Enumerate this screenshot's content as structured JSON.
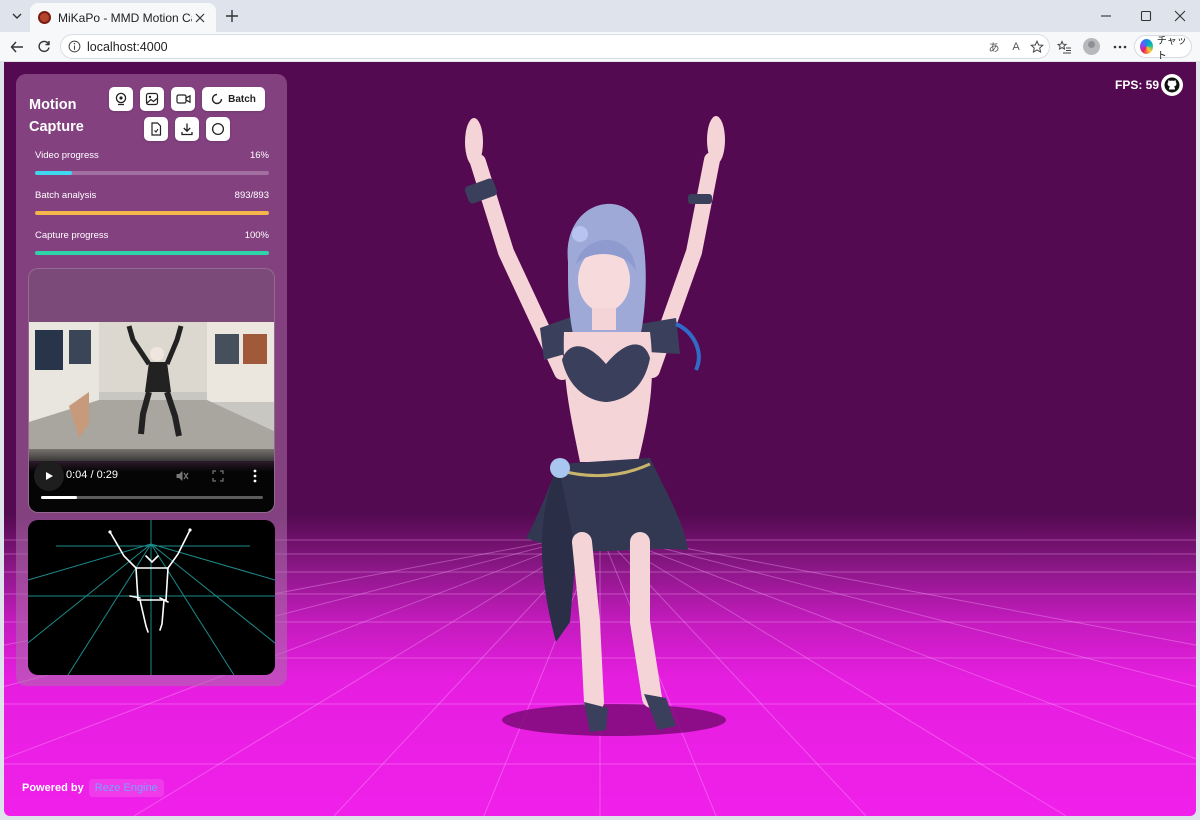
{
  "browser": {
    "tab_title": "MiKaPo - MMD Motion Capture",
    "url": "localhost:4000",
    "copilot_label": "チャット",
    "read_aloud_label": "A",
    "translate_label": "あ"
  },
  "app": {
    "fps_label": "FPS: 59",
    "panel_title": "Motion Capture",
    "buttons": {
      "batch_label": "Batch"
    },
    "progress": [
      {
        "label": "Video progress",
        "value_text": "16%",
        "fraction": 0.16,
        "color": "#3fd7ef"
      },
      {
        "label": "Batch analysis",
        "value_text": "893/893",
        "fraction": 1.0,
        "color": "#f5b54a"
      },
      {
        "label": "Capture progress",
        "value_text": "100%",
        "fraction": 1.0,
        "color": "#2ed3a9"
      }
    ],
    "video": {
      "time": "0:04 / 0:29",
      "seek_fraction": 0.16
    },
    "footer": {
      "powered_label": "Powered by",
      "engine_label": "Reze Engine"
    },
    "colors": {
      "background_top": "#540a50",
      "floor": "#f020ea",
      "panel": "#aa70a8"
    }
  }
}
